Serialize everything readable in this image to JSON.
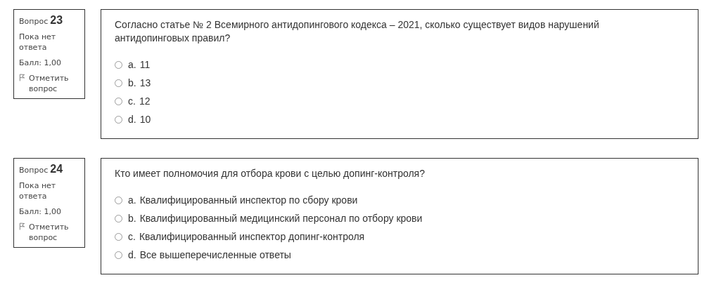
{
  "questions": [
    {
      "label": "Вопрос",
      "number": "23",
      "status": "Пока нет ответа",
      "grade": "Балл: 1,00",
      "flag": "Отметить вопрос",
      "text": "Согласно статье № 2 Всемирного антидопингового кодекса – 2021, сколько существует видов нарушений антидопинговых правил?",
      "options": [
        {
          "letter": "a.",
          "text": "11",
          "selected": false
        },
        {
          "letter": "b.",
          "text": "13",
          "selected": false
        },
        {
          "letter": "c.",
          "text": "12",
          "selected": false
        },
        {
          "letter": "d.",
          "text": "10",
          "selected": false
        }
      ]
    },
    {
      "label": "Вопрос",
      "number": "24",
      "status": "Пока нет ответа",
      "grade": "Балл: 1,00",
      "flag": "Отметить вопрос",
      "text": "Кто имеет полномочия для отбора крови с целью допинг-контроля?",
      "options": [
        {
          "letter": "a.",
          "text": "Квалифицированный инспектор по сбору крови",
          "selected": false
        },
        {
          "letter": "b.",
          "text": "Квалифицированный медицинский персонал по отбору крови",
          "selected": false
        },
        {
          "letter": "c.",
          "text": "Квалифицированный инспектор допинг-контроля",
          "selected": false
        },
        {
          "letter": "d.",
          "text": "Все вышеперечисленные ответы",
          "selected": false
        }
      ]
    }
  ]
}
